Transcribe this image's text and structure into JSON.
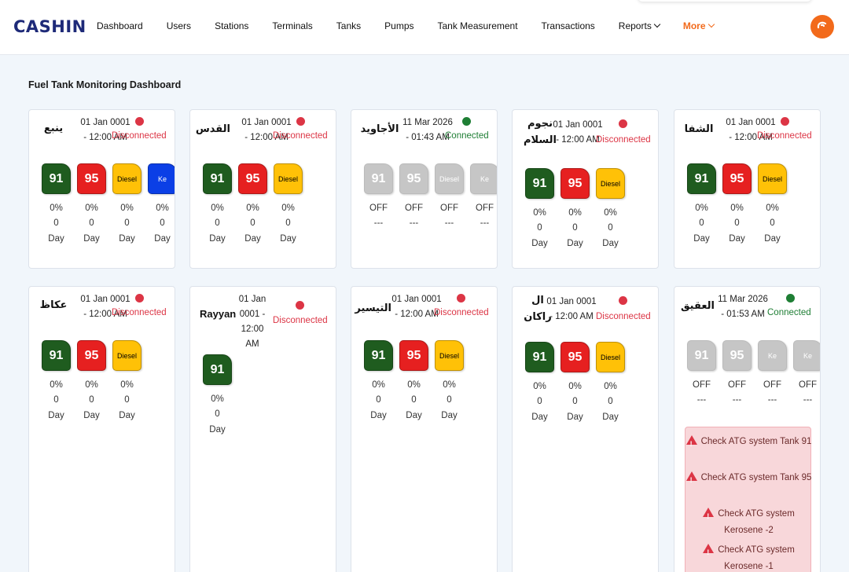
{
  "header": {
    "logo": "CASHIN",
    "nav": [
      "Dashboard",
      "Users",
      "Stations",
      "Terminals",
      "Tanks",
      "Pumps",
      "Tank Measurement",
      "Transactions",
      "Reports",
      "More"
    ]
  },
  "page_title": "Fuel Tank Monitoring Dashboard",
  "colors": {
    "brand": "#1e2a78",
    "accent": "#f26a1b",
    "disconnected": "#dc3545",
    "connected": "#1e7e34",
    "fuel_91": "#1f5c1f",
    "fuel_95": "#e62020",
    "fuel_diesel": "#ffc107",
    "fuel_ke": "#0b3fe6",
    "inactive": "#c6c6c6"
  },
  "stations": [
    {
      "name": "ينبع",
      "date": "01 Jan 0001 - 12:00 AM",
      "status": "Disconnected",
      "connected": false,
      "tanks": [
        {
          "label": "91",
          "type": "91",
          "pct": "0%",
          "val": "0",
          "unit": "Day"
        },
        {
          "label": "95",
          "type": "95",
          "pct": "0%",
          "val": "0",
          "unit": "Day"
        },
        {
          "label": "Diesel",
          "type": "diesel",
          "pct": "0%",
          "val": "0",
          "unit": "Day"
        },
        {
          "label": "Ke",
          "type": "ke",
          "pct": "0%",
          "val": "0",
          "unit": "Day"
        }
      ]
    },
    {
      "name": "القدس",
      "date": "01 Jan 0001 - 12:00 AM",
      "status": "Disconnected",
      "connected": false,
      "tanks": [
        {
          "label": "91",
          "type": "91",
          "pct": "0%",
          "val": "0",
          "unit": "Day"
        },
        {
          "label": "95",
          "type": "95",
          "pct": "0%",
          "val": "0",
          "unit": "Day"
        },
        {
          "label": "Diesel",
          "type": "diesel",
          "pct": "0%",
          "val": "0",
          "unit": "Day"
        }
      ]
    },
    {
      "name": "الأجاويد",
      "date": "11 Mar 2026 - 01:43 AM",
      "status": "Connected",
      "connected": true,
      "tanks": [
        {
          "label": "91",
          "type": "off",
          "pct": "OFF",
          "val": "---"
        },
        {
          "label": "95",
          "type": "off",
          "pct": "OFF",
          "val": "---"
        },
        {
          "label": "Diesel",
          "type": "off",
          "pct": "OFF",
          "val": "---"
        },
        {
          "label": "Ke",
          "type": "off",
          "pct": "OFF",
          "val": "---"
        }
      ]
    },
    {
      "name": "نجوم السلام",
      "date": "01 Jan 0001 - 12:00 AM",
      "status": "Disconnected",
      "connected": false,
      "tanks": [
        {
          "label": "91",
          "type": "91",
          "pct": "0%",
          "val": "0",
          "unit": "Day"
        },
        {
          "label": "95",
          "type": "95",
          "pct": "0%",
          "val": "0",
          "unit": "Day"
        },
        {
          "label": "Diesel",
          "type": "diesel",
          "pct": "0%",
          "val": "0",
          "unit": "Day"
        }
      ]
    },
    {
      "name": "الشفا",
      "date": "01 Jan 0001 - 12:00 AM",
      "status": "Disconnected",
      "connected": false,
      "tanks": [
        {
          "label": "91",
          "type": "91",
          "pct": "0%",
          "val": "0",
          "unit": "Day"
        },
        {
          "label": "95",
          "type": "95",
          "pct": "0%",
          "val": "0",
          "unit": "Day"
        },
        {
          "label": "Diesel",
          "type": "diesel",
          "pct": "0%",
          "val": "0",
          "unit": "Day"
        }
      ]
    },
    {
      "name": "عكاظ",
      "date": "01 Jan 0001 - 12:00 AM",
      "status": "Disconnected",
      "connected": false,
      "tanks": [
        {
          "label": "91",
          "type": "91",
          "pct": "0%",
          "val": "0",
          "unit": "Day"
        },
        {
          "label": "95",
          "type": "95",
          "pct": "0%",
          "val": "0",
          "unit": "Day"
        },
        {
          "label": "Diesel",
          "type": "diesel",
          "pct": "0%",
          "val": "0",
          "unit": "Day"
        }
      ]
    },
    {
      "name": "Rayyan",
      "date": "01 Jan 0001 - 12:00 AM",
      "status": "Disconnected",
      "connected": false,
      "tanks": [
        {
          "label": "91",
          "type": "91",
          "pct": "0%",
          "val": "0",
          "unit": "Day"
        }
      ]
    },
    {
      "name": "التيسير",
      "date": "01 Jan 0001 - 12:00 AM",
      "status": "Disconnected",
      "connected": false,
      "tanks": [
        {
          "label": "91",
          "type": "91",
          "pct": "0%",
          "val": "0",
          "unit": "Day"
        },
        {
          "label": "95",
          "type": "95",
          "pct": "0%",
          "val": "0",
          "unit": "Day"
        },
        {
          "label": "Diesel",
          "type": "diesel",
          "pct": "0%",
          "val": "0",
          "unit": "Day"
        }
      ]
    },
    {
      "name": "ال راكان",
      "date": "01 Jan 0001 - 12:00 AM",
      "status": "Disconnected",
      "connected": false,
      "tanks": [
        {
          "label": "91",
          "type": "91",
          "pct": "0%",
          "val": "0",
          "unit": "Day"
        },
        {
          "label": "95",
          "type": "95",
          "pct": "0%",
          "val": "0",
          "unit": "Day"
        },
        {
          "label": "Diesel",
          "type": "diesel",
          "pct": "0%",
          "val": "0",
          "unit": "Day"
        }
      ]
    },
    {
      "name": "العقيق",
      "date": "11 Mar 2026 - 01:53 AM",
      "status": "Connected",
      "connected": true,
      "tanks": [
        {
          "label": "91",
          "type": "off",
          "pct": "OFF",
          "val": "---"
        },
        {
          "label": "95",
          "type": "off",
          "pct": "OFF",
          "val": "---"
        },
        {
          "label": "Ke",
          "type": "off",
          "pct": "OFF",
          "val": "---"
        },
        {
          "label": "Ke",
          "type": "off",
          "pct": "OFF",
          "val": "---"
        }
      ],
      "alerts": [
        "Check ATG system Tank 91",
        "Check ATG system Tank 95",
        "Check ATG system Kerosene -2",
        "Check ATG system Kerosene -1"
      ]
    }
  ]
}
